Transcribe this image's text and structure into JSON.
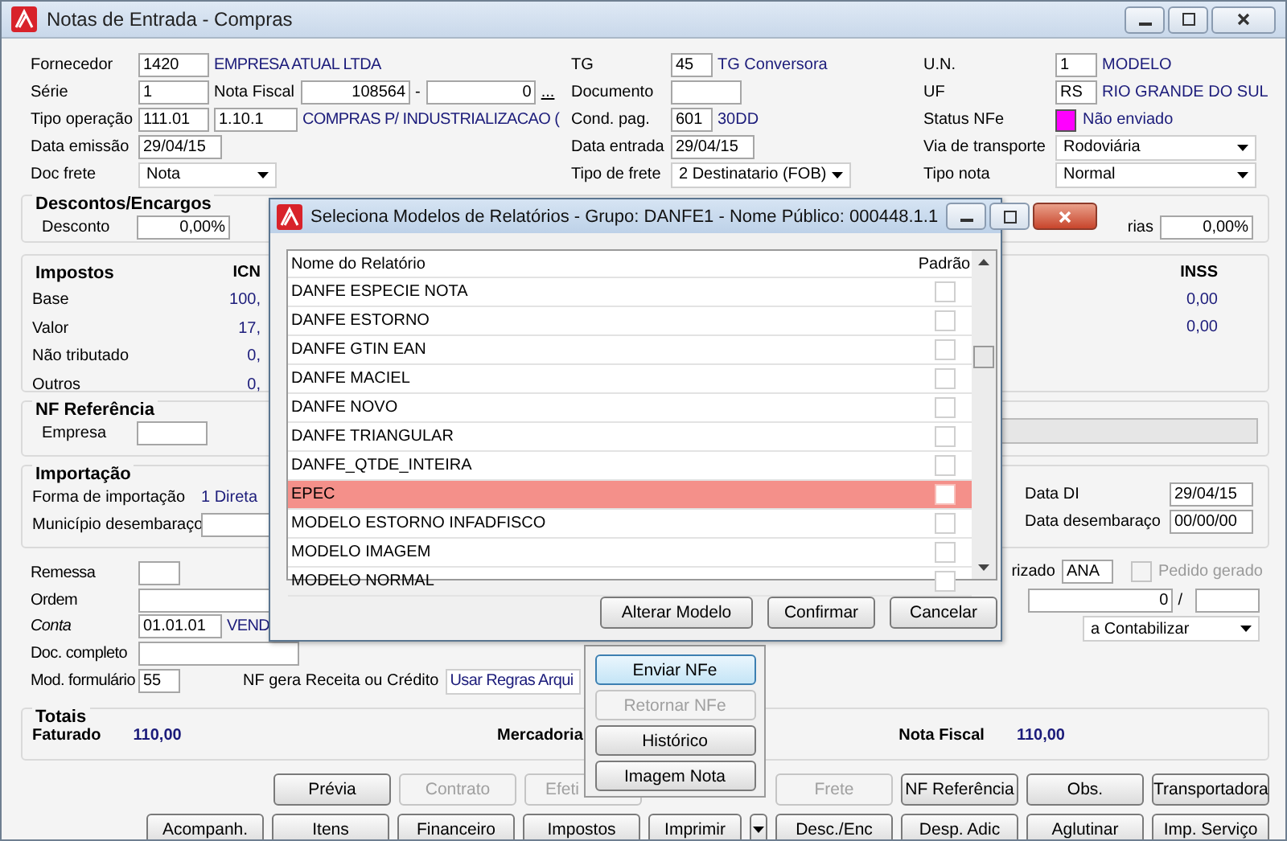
{
  "window": {
    "title": "Notas de Entrada - Compras"
  },
  "header_columns": [
    [
      {
        "label": "Fornecedor",
        "parts": [
          {
            "kind": "code",
            "value": "1420"
          },
          {
            "kind": "text",
            "value": "EMPRESA ATUAL LTDA"
          }
        ]
      },
      {
        "label": "Série",
        "parts": [
          {
            "kind": "code",
            "value": "1"
          },
          {
            "kind": "label",
            "value": "Nota Fiscal"
          },
          {
            "kind": "num",
            "value": "108564"
          },
          {
            "kind": "label",
            "value": "-"
          },
          {
            "kind": "num",
            "value": "0"
          },
          {
            "kind": "link",
            "value": "..."
          }
        ]
      },
      {
        "label": "Tipo operação",
        "parts": [
          {
            "kind": "code",
            "value": "111.01"
          },
          {
            "kind": "medium",
            "value": "1.10.1"
          },
          {
            "kind": "text",
            "value": "COMPRAS P/ INDUSTRIALIZACAO ("
          }
        ]
      },
      {
        "label": "Data emissão",
        "parts": [
          {
            "kind": "medium",
            "value": "29/04/15"
          }
        ]
      },
      {
        "label": "Doc frete",
        "parts": [
          {
            "kind": "select",
            "value": "Nota"
          }
        ]
      }
    ],
    [
      {
        "label": "TG",
        "parts": [
          {
            "kind": "short",
            "value": "45"
          },
          {
            "kind": "text",
            "value": "TG Conversora"
          }
        ]
      },
      {
        "label": "Documento",
        "parts": [
          {
            "kind": "code"
          }
        ]
      },
      {
        "label": "Cond. pag.",
        "parts": [
          {
            "kind": "short",
            "value": "601"
          },
          {
            "kind": "text",
            "value": "30DD"
          }
        ]
      },
      {
        "label": "Data entrada",
        "parts": [
          {
            "kind": "medium",
            "value": "29/04/15"
          }
        ]
      },
      {
        "label": "Tipo de frete",
        "parts": [
          {
            "kind": "select",
            "value": "2 Destinatario (FOB)"
          }
        ]
      }
    ],
    [
      {
        "label": "U.N.",
        "parts": [
          {
            "kind": "short",
            "value": "1"
          },
          {
            "kind": "text",
            "value": "MODELO"
          }
        ]
      },
      {
        "label": "UF",
        "parts": [
          {
            "kind": "short",
            "value": "RS"
          },
          {
            "kind": "text",
            "value": "RIO GRANDE DO SUL"
          }
        ]
      },
      {
        "label": "Status NFe",
        "parts": [
          {
            "kind": "swatch",
            "color": "#ff00ff"
          },
          {
            "kind": "text",
            "value": "Não enviado"
          }
        ]
      },
      {
        "label": "Via de transporte",
        "parts": [
          {
            "kind": "select",
            "value": "Rodoviária"
          }
        ]
      },
      {
        "label": "Tipo nota",
        "parts": [
          {
            "kind": "select",
            "value": "Normal"
          }
        ]
      }
    ]
  ],
  "descontos": {
    "title": "Descontos/Encargos",
    "desconto": {
      "label": "Desconto",
      "value": "0,00%"
    },
    "right": {
      "label": "rias",
      "value": "0,00%"
    }
  },
  "impostos": {
    "title": "Impostos",
    "col_header": "ICN",
    "rows": [
      {
        "label": "Base",
        "value": "100,"
      },
      {
        "label": "Valor",
        "value": "17,"
      },
      {
        "label": "Não tributado",
        "value": "0,"
      },
      {
        "label": "Outros",
        "value": "0,"
      }
    ],
    "inss": {
      "header": "INSS",
      "values": [
        "0,00",
        "0,00"
      ]
    }
  },
  "nf_referencia": {
    "title": "NF Referência",
    "empresa_label": "Empresa"
  },
  "importacao": {
    "title": "Importação",
    "forma": {
      "label": "Forma de importação",
      "value": "1 Direta"
    },
    "municipio_label": "Município desembaraço",
    "dates": [
      {
        "label": "Data DI",
        "value": "29/04/15"
      },
      {
        "label": "Data desembaraço",
        "value": "00/00/00"
      }
    ]
  },
  "extra_fields": [
    {
      "label": "Remessa",
      "italic": false,
      "parts": [
        {
          "kind": "short"
        }
      ]
    },
    {
      "label": "Ordem",
      "italic": false,
      "parts": [
        {
          "kind": "wide"
        }
      ]
    },
    {
      "label": "Conta",
      "italic": true,
      "parts": [
        {
          "kind": "medium",
          "value": "01.01.01"
        },
        {
          "kind": "text",
          "value": "VEND"
        }
      ]
    },
    {
      "label": "Doc. completo",
      "italic": false,
      "parts": [
        {
          "kind": "wide"
        }
      ]
    },
    {
      "label": "Mod. formulário",
      "italic": false,
      "parts": [
        {
          "kind": "short",
          "value": "55"
        }
      ]
    }
  ],
  "nf_gera": {
    "label": "NF gera Receita ou Crédito",
    "value": "Usar Regras Arqui"
  },
  "right_fields": {
    "autorizado": {
      "label": "rizado",
      "value": "ANA"
    },
    "pedido_gerado": {
      "label": "Pedido gerado",
      "checked": false,
      "disabled": true
    },
    "numero": {
      "value": "0",
      "sep": "/"
    },
    "contabil": {
      "value": "a Contabilizar"
    }
  },
  "totais": {
    "title": "Totais",
    "items": [
      {
        "label": "Faturado",
        "value": "110,00"
      },
      {
        "label": "Mercadoria"
      },
      {
        "label": "Nota Fiscal",
        "value": "110,00"
      }
    ]
  },
  "buttons_row1": [
    {
      "label": "Prévia",
      "disabled": false
    },
    {
      "label": "Contrato",
      "disabled": true
    },
    {
      "label": "Efeti",
      "disabled": true
    },
    {
      "label": "Frete",
      "disabled": true
    },
    {
      "label": "NF Referência",
      "disabled": false
    },
    {
      "label": "Obs.",
      "disabled": false
    },
    {
      "label": "Transportadora",
      "disabled": false
    }
  ],
  "buttons_row2": [
    {
      "label": "Acompanh.",
      "disabled": false
    },
    {
      "label": "Itens",
      "disabled": false
    },
    {
      "label": "Financeiro",
      "disabled": false
    },
    {
      "label": "Impostos",
      "disabled": false
    },
    {
      "label": "Imprimir",
      "disabled": false,
      "dropdown": true
    },
    {
      "label": "Desc./Enc",
      "disabled": false
    },
    {
      "label": "Desp. Adic",
      "disabled": false
    },
    {
      "label": "Aglutinar",
      "disabled": false
    },
    {
      "label": "Imp. Serviço",
      "disabled": false
    }
  ],
  "print_menu": [
    {
      "label": "Enviar NFe",
      "selected": true,
      "disabled": false
    },
    {
      "label": "Retornar NFe",
      "selected": false,
      "disabled": true
    },
    {
      "label": "Histórico",
      "selected": false,
      "disabled": false
    },
    {
      "label": "Imagem Nota",
      "selected": false,
      "disabled": false
    }
  ],
  "dialog": {
    "title": "Seleciona Modelos de Relatórios - Grupo: DANFE1 - Nome Público: 000448.1.1",
    "columns": [
      "Nome do Relatório",
      "Padrão"
    ],
    "rows": [
      {
        "name": "DANFE ESPECIE NOTA",
        "default": false,
        "selected": false
      },
      {
        "name": "DANFE ESTORNO",
        "default": false,
        "selected": false
      },
      {
        "name": "DANFE GTIN EAN",
        "default": false,
        "selected": false
      },
      {
        "name": "DANFE MACIEL",
        "default": false,
        "selected": false
      },
      {
        "name": "DANFE NOVO",
        "default": false,
        "selected": false
      },
      {
        "name": "DANFE TRIANGULAR",
        "default": false,
        "selected": false
      },
      {
        "name": "DANFE_QTDE_INTEIRA",
        "default": false,
        "selected": false
      },
      {
        "name": "EPEC",
        "default": false,
        "selected": true
      },
      {
        "name": "MODELO ESTORNO INFADFISCO",
        "default": false,
        "selected": false
      },
      {
        "name": "MODELO IMAGEM",
        "default": false,
        "selected": false
      },
      {
        "name": "MODELO NORMAL",
        "default": false,
        "selected": false
      }
    ],
    "buttons": [
      "Alterar Modelo",
      "Confirmar",
      "Cancelar"
    ]
  }
}
